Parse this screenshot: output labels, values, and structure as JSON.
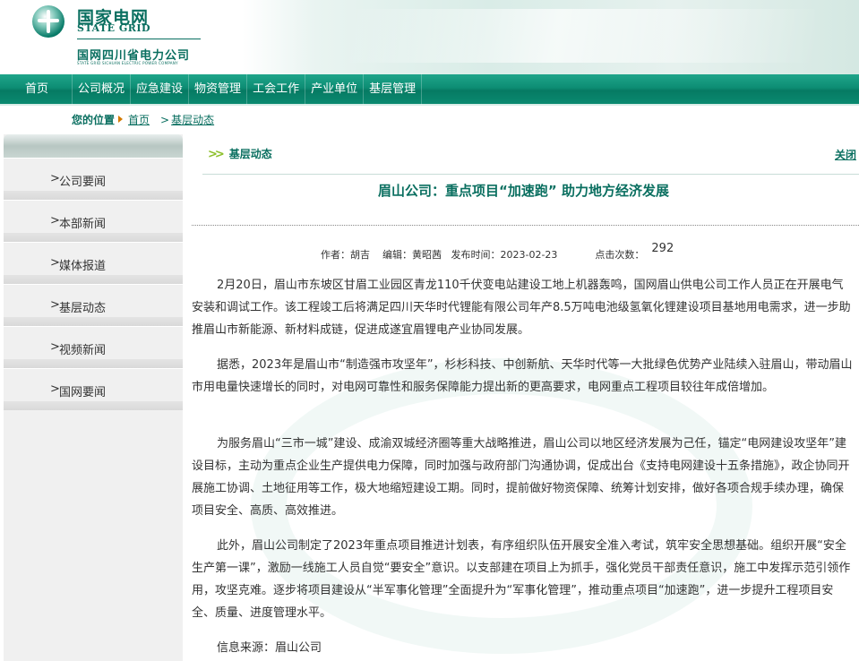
{
  "header": {
    "logo_cn": "国家电网",
    "logo_en": "STATE GRID",
    "company_cn": "国网四川省电力公司",
    "company_en": "STATE GRID SICHUAN ELECTRIC POWER COMPANY"
  },
  "nav": {
    "items": [
      "首页",
      "公司概况",
      "应急建设",
      "物资管理",
      "工会工作",
      "产业单位",
      "基层管理"
    ]
  },
  "breadcrumb": {
    "label": "您的位置",
    "home": "首页",
    "current": "基层动态"
  },
  "sidebar": {
    "items": [
      "公司要闻",
      "本部新闻",
      "媒体报道",
      "基层动态",
      "视频新闻",
      "国网要闻"
    ]
  },
  "main": {
    "section": "基层动态",
    "close": "关闭",
    "title": "眉山公司：重点项目“加速跑” 助力地方经济发展",
    "meta": {
      "author": "作者：胡吉",
      "editor": "编辑：黄昭茜",
      "date": "发布时间：2023-02-23",
      "clicks_label": "点击次数：",
      "clicks": "292"
    },
    "paragraphs": [
      "2月20日，眉山市东坡区甘眉工业园区青龙110千伏变电站建设工地上机器轰鸣，国网眉山供电公司工作人员正在开展电气安装和调试工作。该工程竣工后将满足四川天华时代锂能有限公司年产8.5万吨电池级氢氧化锂建设项目基地用电需求，进一步助推眉山市新能源、新材料成链，促进成遂宜眉锂电产业协同发展。",
      "据悉，2023年是眉山市“制造强市攻坚年”，杉杉科技、中创新航、天华时代等一大批绿色优势产业陆续入驻眉山，带动眉山市用电量快速增长的同时，对电网可靠性和服务保障能力提出新的更高要求，电网重点工程项目较往年成倍增加。",
      "为服务眉山“三市一城”建设、成渝双城经济圈等重大战略推进，眉山公司以地区经济发展为己任，锚定“电网建设攻坚年”建设目标，主动为重点企业生产提供电力保障，同时加强与政府部门沟通协调，促成出台《支持电网建设十五条措施》，政企协同开展施工协调、土地征用等工作，极大地缩短建设工期。同时，提前做好物资保障、统筹计划安排，做好各项合规手续办理，确保项目安全、高质、高效推进。",
      "此外，眉山公司制定了2023年重点项目推进计划表，有序组织队伍开展安全准入考试，筑牢安全思想基础。组织开展“安全生产第一课”，激励一线施工人员自觉“要安全”意识。以支部建在项目上为抓手，强化党员干部责任意识，施工中发挥示范引领作用，攻坚克难。逐步将项目建设从“半军事化管理”全面提升为“军事化管理”，推动重点项目“加速跑”，进一步提升工程项目安全、质量、进度管理水平。"
    ],
    "source": "信息来源：眉山公司"
  },
  "colors": {
    "brand_green": "#0a6f60",
    "nav_green": "#0d8d74",
    "arrow_orange": "#d37a00"
  }
}
